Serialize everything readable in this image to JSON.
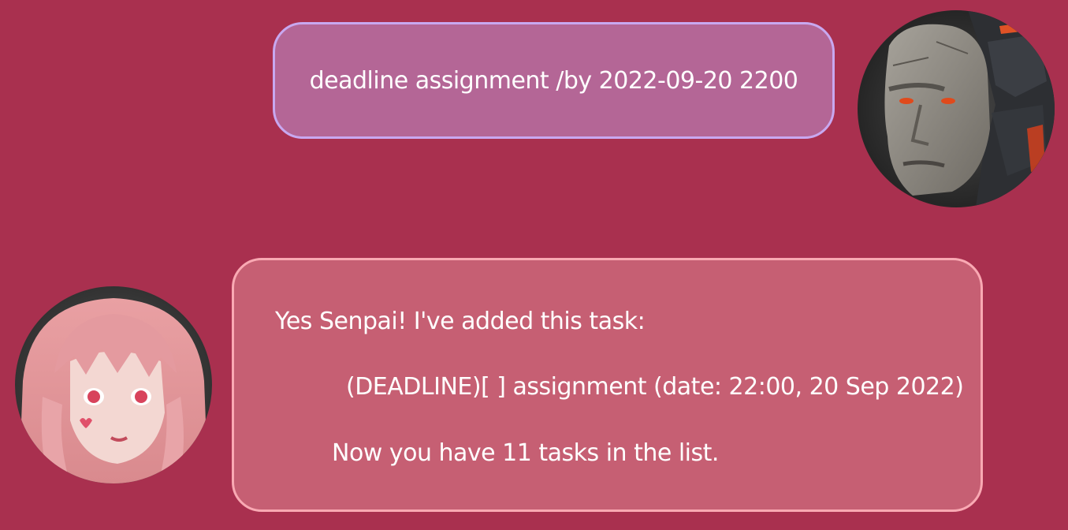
{
  "conversation": {
    "user_message": {
      "text": "deadline assignment /by 2022-09-20 2200",
      "avatar_icon": "user-avatar-icon"
    },
    "bot_message": {
      "lines": [
        "Yes Senpai! I've added this task:",
        "(DEADLINE)[ ] assignment (date: 22:00, 20 Sep 2022)",
        "Now you have 11 tasks in the list."
      ],
      "avatar_icon": "bot-avatar-icon"
    }
  },
  "colors": {
    "background": "#a9304f",
    "user_bubble_fill": "#b46696",
    "user_bubble_border": "#c8a8f0",
    "bot_bubble_fill": "#c65f73",
    "bot_bubble_border": "#f9a9b3",
    "text": "#ffffff"
  }
}
